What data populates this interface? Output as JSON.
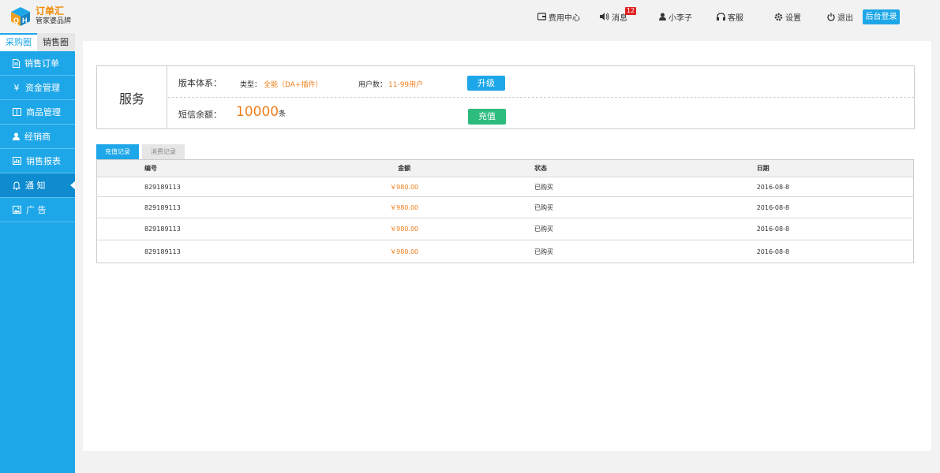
{
  "header": {
    "logo_title": "订单汇",
    "logo_subtitle": "管家婆品牌",
    "nav": {
      "billing": "费用中心",
      "messages": "消息",
      "messages_badge": "12",
      "user": "小李子",
      "service": "客服",
      "settings": "设置",
      "logout": "退出"
    },
    "admin_login": "后台登录"
  },
  "sidebar": {
    "tabs": [
      "采购圈",
      "销售圈"
    ],
    "items": [
      {
        "label": "销售订单",
        "icon": "document-icon"
      },
      {
        "label": "资金管理",
        "icon": "yen-icon"
      },
      {
        "label": "商品管理",
        "icon": "book-icon"
      },
      {
        "label": "经销商",
        "icon": "user-icon"
      },
      {
        "label": "销售报表",
        "icon": "chart-icon"
      },
      {
        "label": "通 知",
        "icon": "bell-icon"
      },
      {
        "label": "广 告",
        "icon": "image-icon"
      }
    ],
    "active_index": 5
  },
  "service": {
    "title": "服务",
    "version_label": "版本体系：",
    "type_label": "类型：",
    "type_value": "全能（DA+插件）",
    "users_label": "用户数：",
    "users_value": "11-99用户",
    "upgrade_button": "升级",
    "sms_label": "短信余额：",
    "sms_amount": "10000",
    "sms_unit": "条",
    "recharge_button": "充值"
  },
  "records": {
    "tabs": [
      "充值记录",
      "消费记录"
    ],
    "columns": [
      "编号",
      "金额",
      "状态",
      "日期"
    ],
    "rows": [
      {
        "id": "829189113",
        "amount": "￥980.00",
        "status": "已购买",
        "date": "2016-08-8"
      },
      {
        "id": "829189113",
        "amount": "￥980.00",
        "status": "已购买",
        "date": "2016-08-8"
      },
      {
        "id": "829189113",
        "amount": "￥980.00",
        "status": "已购买",
        "date": "2016-08-8"
      },
      {
        "id": "829189113",
        "amount": "￥980.00",
        "status": "已购买",
        "date": "2016-08-8"
      }
    ]
  },
  "colors": {
    "accent_blue": "#1ea7e8",
    "accent_orange": "#f07f1e",
    "recharge_green": "#2dbc7e",
    "badge_red": "#e02020"
  }
}
